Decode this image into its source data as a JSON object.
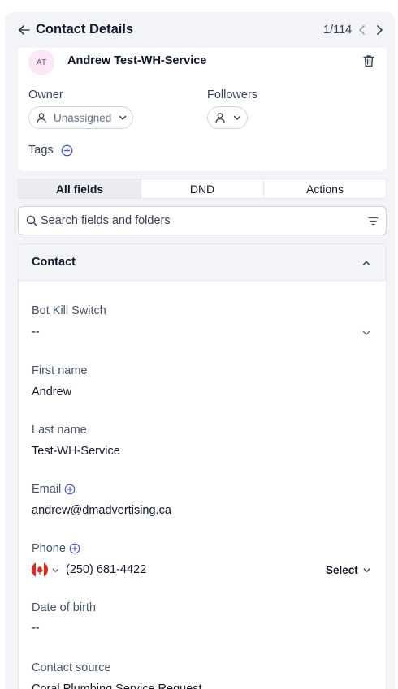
{
  "header": {
    "title": "Contact Details",
    "pager": "1/114"
  },
  "contact": {
    "initials": "AT",
    "name": "Andrew Test-WH-Service",
    "owner_label": "Owner",
    "owner_value": "Unassigned",
    "followers_label": "Followers",
    "tags_label": "Tags"
  },
  "tabs": [
    {
      "label": "All fields",
      "active": true
    },
    {
      "label": "DND",
      "active": false
    },
    {
      "label": "Actions",
      "active": false
    }
  ],
  "search": {
    "placeholder": "Search fields and folders"
  },
  "section": {
    "title": "Contact",
    "fields": {
      "bot_kill_switch": {
        "label": "Bot Kill Switch",
        "value": "--"
      },
      "first_name": {
        "label": "First name",
        "value": "Andrew"
      },
      "last_name": {
        "label": "Last name",
        "value": "Test-WH-Service"
      },
      "email": {
        "label": "Email",
        "value": "andrew@dmadvertising.ca"
      },
      "phone": {
        "label": "Phone",
        "value": "(250) 681-4422",
        "country": "CA",
        "select_label": "Select"
      },
      "date_of_birth": {
        "label": "Date of birth",
        "value": "--"
      },
      "contact_source": {
        "label": "Contact source",
        "value": "Coral Plumbing Service Request"
      }
    }
  },
  "colors": {
    "panel_bg": "#f2f4f7",
    "active_tab_bg": "#eaecf0",
    "avatar_bg": "#fce7f6",
    "accent_plus": "#3e4ccf"
  }
}
